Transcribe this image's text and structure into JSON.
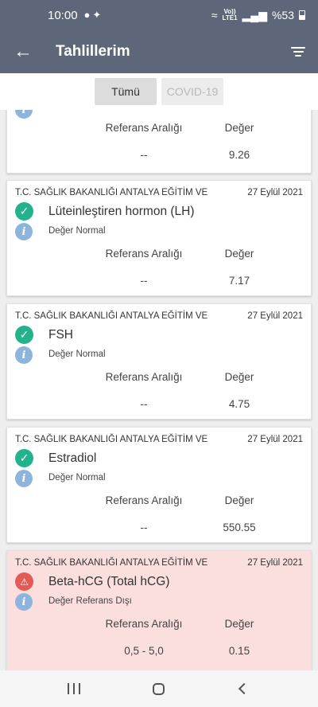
{
  "status_bar": {
    "time": "10:00",
    "network_top": "Vo))",
    "network_bottom": "LTE1",
    "battery": "%53"
  },
  "app_bar": {
    "back_icon": "arrow-left-icon",
    "title": "Tahlillerim",
    "filter_icon": "filter-icon"
  },
  "tabs": [
    {
      "label": "Tümü",
      "active": true
    },
    {
      "label": "COVID-19",
      "active": false
    }
  ],
  "labels": {
    "reference_range": "Referans Aralığı",
    "value": "Değer"
  },
  "results": [
    {
      "institution": "",
      "date": "",
      "name": "",
      "note": "",
      "reference": "--",
      "value": "9.26",
      "status": "normal"
    },
    {
      "institution": "T.C. SAĞLIK BAKANLIĞI ANTALYA EĞİTİM VE",
      "date": "27 Eylül 2021",
      "name": "Lüteinleştiren hormon (LH)",
      "note": "Değer Normal",
      "reference": "--",
      "value": "7.17",
      "status": "normal"
    },
    {
      "institution": "T.C. SAĞLIK BAKANLIĞI ANTALYA EĞİTİM VE",
      "date": "27 Eylül 2021",
      "name": "FSH",
      "note": "Değer Normal",
      "reference": "--",
      "value": "4.75",
      "status": "normal"
    },
    {
      "institution": "T.C. SAĞLIK BAKANLIĞI ANTALYA EĞİTİM VE",
      "date": "27 Eylül 2021",
      "name": "Estradiol",
      "note": "Değer Normal",
      "reference": "--",
      "value": "550.55",
      "status": "normal"
    },
    {
      "institution": "T.C. SAĞLIK BAKANLIĞI ANTALYA EĞİTİM VE",
      "date": "27 Eylül 2021",
      "name": "Beta-hCG (Total hCG)",
      "note": "Değer Referans Dışı",
      "reference": "0,5 - 5,0",
      "value": "0.15",
      "status": "abnormal"
    }
  ],
  "colors": {
    "app_bar": "#5e6779",
    "normal_check": "#23b28c",
    "warning": "#e45a54",
    "abnormal_card_bg": "#fbdede",
    "info": "#8cb4dd"
  },
  "nav_bar": {
    "recents_icon": "recents-icon",
    "home_icon": "home-icon",
    "back_icon": "back-nav-icon"
  }
}
